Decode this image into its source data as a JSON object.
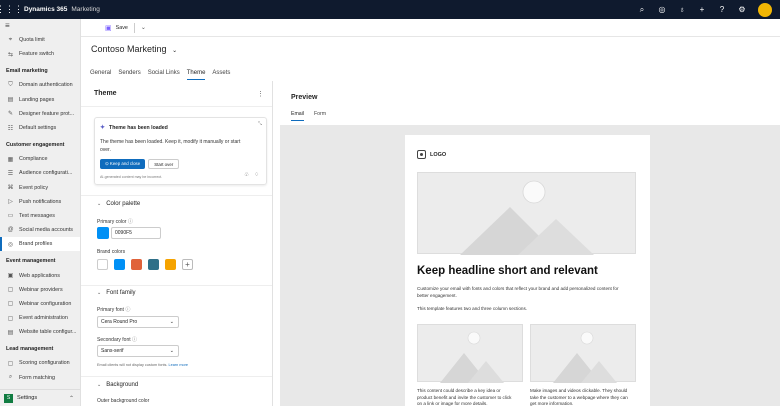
{
  "topbar": {
    "app_name": "Dynamics 365",
    "app_area": "Marketing",
    "icons": [
      "search-icon",
      "target-icon",
      "lightbulb-icon",
      "plus-icon",
      "help-icon",
      "gear-icon"
    ]
  },
  "sidebar": {
    "items_top": [
      {
        "label": "Quota limit",
        "icon": "quota-icon"
      },
      {
        "label": "Feature switch",
        "icon": "switch-icon"
      }
    ],
    "groups": [
      {
        "title": "Email marketing",
        "items": [
          {
            "label": "Domain authentication",
            "icon": "domain-icon"
          },
          {
            "label": "Landing pages",
            "icon": "page-icon"
          },
          {
            "label": "Designer feature prot...",
            "icon": "designer-icon"
          },
          {
            "label": "Default settings",
            "icon": "settings-icon"
          }
        ]
      },
      {
        "title": "Customer engagement",
        "items": [
          {
            "label": "Compliance",
            "icon": "compliance-icon"
          },
          {
            "label": "Audience configurati...",
            "icon": "audience-icon"
          },
          {
            "label": "Event policy",
            "icon": "event-policy-icon"
          },
          {
            "label": "Push notifications",
            "icon": "push-icon"
          },
          {
            "label": "Text messages",
            "icon": "message-icon"
          },
          {
            "label": "Social media accounts",
            "icon": "social-icon"
          },
          {
            "label": "Brand profiles",
            "icon": "brand-icon",
            "active": true
          }
        ]
      },
      {
        "title": "Event management",
        "items": [
          {
            "label": "Web applications",
            "icon": "web-app-icon"
          },
          {
            "label": "Webinar providers",
            "icon": "webinar-icon"
          },
          {
            "label": "Webinar configuration",
            "icon": "webinar-config-icon"
          },
          {
            "label": "Event administration",
            "icon": "event-admin-icon"
          },
          {
            "label": "Website table configur...",
            "icon": "table-icon"
          }
        ]
      },
      {
        "title": "Lead management",
        "items": [
          {
            "label": "Scoring configuration",
            "icon": "scoring-icon"
          },
          {
            "label": "Form matching",
            "icon": "form-icon"
          }
        ]
      }
    ],
    "area_switcher": {
      "badge": "S",
      "label": "Settings"
    }
  },
  "cmdbar": {
    "save_label": "Save"
  },
  "page": {
    "title": "Contoso Marketing",
    "tabs": [
      "General",
      "Senders",
      "Social Links",
      "Theme",
      "Assets"
    ],
    "active_tab": "Theme"
  },
  "theme_panel": {
    "title": "Theme",
    "ai_card": {
      "title": "Theme has been loaded",
      "body": "The theme has been loaded. Keep it, modify it manually or start over.",
      "keep_label": "Keep and close",
      "start_over_label": "Start over",
      "disclaimer": "AI-generated content may be incorrect."
    },
    "color_palette": {
      "heading": "Color palette",
      "primary_label": "Primary color",
      "primary_value": "0090F5",
      "primary_color": "#0090f5",
      "brand_label": "Brand colors",
      "brand_colors": [
        "#ffffff",
        "#0090f5",
        "#e0623a",
        "#2e6f88",
        "#f5a300"
      ]
    },
    "font_family": {
      "heading": "Font family",
      "primary_label": "Primary font",
      "primary_value": "Cera Round Pro",
      "secondary_label": "Secondary font",
      "secondary_value": "Sans-serif",
      "note": "Email clients will not display custom fonts.",
      "note_link": "Learn more"
    },
    "background": {
      "heading": "Background",
      "outer_label": "Outer background color"
    }
  },
  "preview": {
    "title": "Preview",
    "tabs": [
      "Email",
      "Form"
    ],
    "active_tab": "Email",
    "email": {
      "logo_text": "LOGO",
      "headline": "Keep headline short and relevant",
      "body1": "Customize your email with fonts and colors that reflect your brand and add personalized content for better engagement.",
      "body2": "This template features two and three column sections.",
      "col1_text": "This content could describe a key idea or product benefit and invite the customer to click on a link or image for more details.",
      "col2_text": "Make images and videos clickable. They should take the customer to a webpage where they can get more information."
    }
  }
}
